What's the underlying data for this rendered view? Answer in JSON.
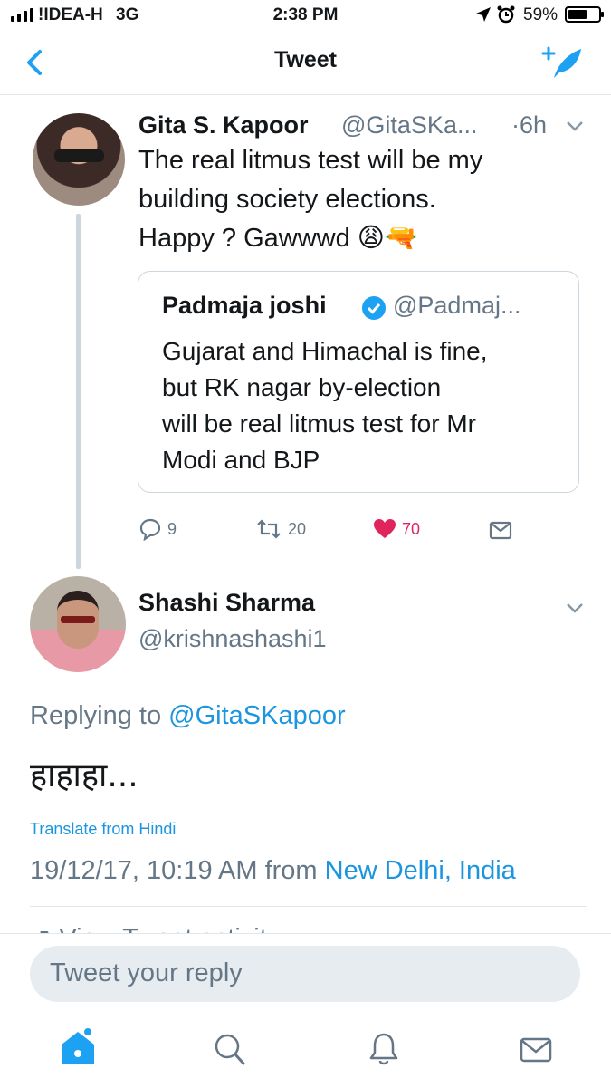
{
  "status_bar": {
    "carrier": "!IDEA-H",
    "network": "3G",
    "time": "2:38 PM",
    "battery": "59%"
  },
  "nav": {
    "title": "Tweet"
  },
  "parent_tweet": {
    "name": "Gita S. Kapoor",
    "handle": "@GitaSKa...",
    "time": "·6h",
    "text_lines": [
      "The real litmus test will be my",
      "building society elections.",
      "Happy ? Gawwwd 😩🔫"
    ],
    "quote": {
      "name": "Padmaja joshi",
      "handle": "@Padmaj...",
      "text_lines": [
        "Gujarat and Himachal is fine,",
        "but RK nagar by-election",
        "will be real litmus test for Mr",
        "Modi and BJP"
      ]
    },
    "actions": {
      "replies": "9",
      "retweets": "20",
      "likes": "70"
    }
  },
  "main_tweet": {
    "name": "Shashi Sharma",
    "handle": "@krishnashashi1",
    "replying_prefix": "Replying to ",
    "replying_handle": "@GitaSKapoor",
    "text": "हाहाहा...",
    "translate": "Translate from Hindi",
    "datetime": "19/12/17, 10:19 AM from ",
    "location": "New Delhi, India",
    "activity_partial": "View Tweet activity"
  },
  "reply_box": {
    "placeholder": "Tweet your reply"
  },
  "colors": {
    "accent": "#1da1f2",
    "like": "#e0245e",
    "muted": "#657786"
  }
}
